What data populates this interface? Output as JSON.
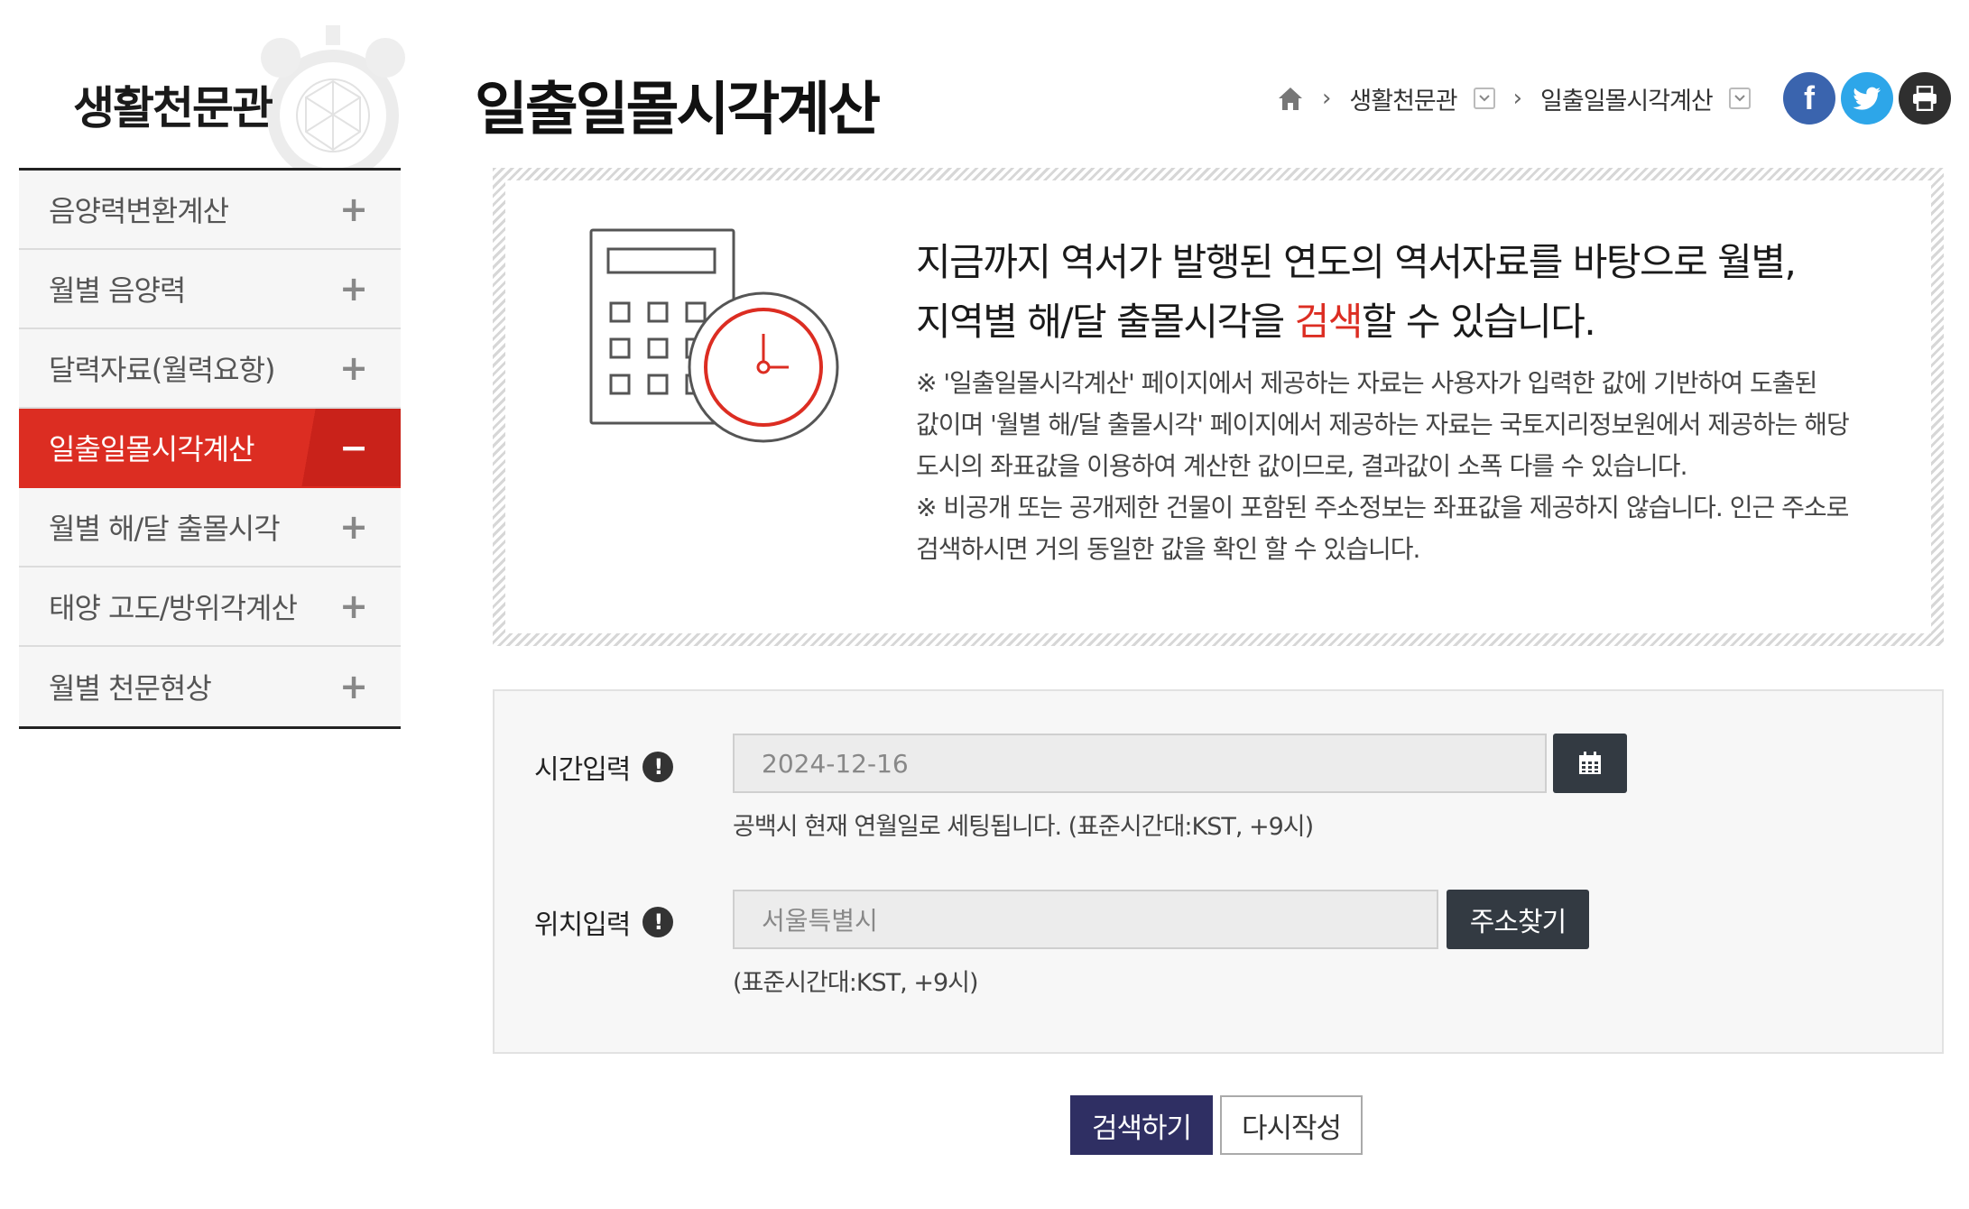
{
  "sidebar": {
    "title": "생활천문관",
    "items": [
      {
        "label": "음양력변환계산",
        "toggle": "+"
      },
      {
        "label": "월별 음양력",
        "toggle": "+"
      },
      {
        "label": "달력자료(월력요항)",
        "toggle": "+"
      },
      {
        "label": "일출일몰시각계산",
        "toggle": "−"
      },
      {
        "label": "월별 해/달 출몰시각",
        "toggle": "+"
      },
      {
        "label": "태양 고도/방위각계산",
        "toggle": "+"
      },
      {
        "label": "월별 천문현상",
        "toggle": "+"
      }
    ],
    "active_index": 3
  },
  "header": {
    "title": "일출일몰시각계산",
    "breadcrumb": [
      "생활천문관",
      "일출일몰시각계산"
    ]
  },
  "share": {
    "facebook": "f"
  },
  "info": {
    "lead_line1": "지금까지 역서가 발행된 연도의 역서자료를 바탕으로 월별,",
    "lead_line2_pre": "지역별 해/달 출몰시각을 ",
    "lead_highlight": "검색",
    "lead_line2_post": "할 수 있습니다.",
    "note1_line1": "※ '일출일몰시각계산' 페이지에서 제공하는 자료는 사용자가 입력한 값에 기반하여 도출된",
    "note1_line2": "값이며 '월별 해/달 출몰시각' 페이지에서 제공하는 자료는 국토지리정보원에서 제공하는 해당",
    "note1_line3": "도시의 좌표값을 이용하여 계산한 값이므로, 결과값이 소폭 다를 수 있습니다.",
    "note2_line1": "※ 비공개 또는 공개제한 건물이 포함된 주소정보는 좌표값을 제공하지 않습니다. 인근 주소로",
    "note2_line2": "검색하시면 거의 동일한 값을 확인 할 수 있습니다."
  },
  "form": {
    "time_label": "시간입력",
    "time_value": "2024-12-16",
    "time_hint": "공백시 현재 연월일로 세팅됩니다. (표준시간대:KST, +9시)",
    "location_label": "위치입력",
    "location_value": "서울특별시",
    "location_hint": "(표준시간대:KST, +9시)",
    "address_button": "주소찾기",
    "info_mark": "!"
  },
  "actions": {
    "search": "검색하기",
    "reset": "다시작성"
  },
  "colors": {
    "accent_red": "#dc2d22",
    "dark_button": "#333a42",
    "search_button": "#2f2f63",
    "facebook": "#3a64ae",
    "twitter": "#2da6e9"
  }
}
